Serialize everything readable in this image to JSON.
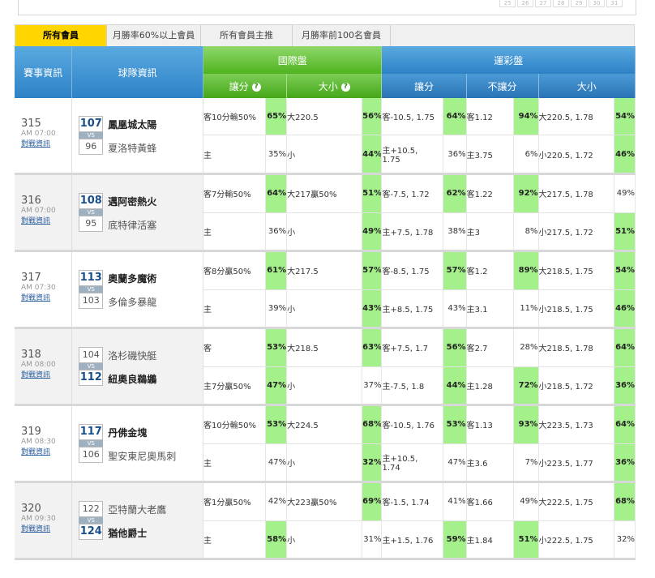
{
  "calendar_days": [
    "25",
    "26",
    "27",
    "28",
    "29",
    "30",
    "31"
  ],
  "tabs": [
    {
      "label": "所有會員",
      "active": true
    },
    {
      "label": "月勝率60%以上會員",
      "active": false
    },
    {
      "label": "所有會員主推",
      "active": false
    },
    {
      "label": "月勝率前100名會員",
      "active": false
    }
  ],
  "header": {
    "match_info": "賽事資訊",
    "team_info": "球隊資訊",
    "intl": "國際盤",
    "sports_lottery": "運彩盤",
    "intl_spread": "讓分",
    "intl_total": "大小",
    "help_icon": "?",
    "lot_spread": "讓分",
    "lot_nospread": "不讓分",
    "lot_total": "大小"
  },
  "colors": {
    "highlight": "#a4f08a",
    "tab_active": "#ffd600",
    "green_header": "#4eb31d",
    "blue_header": "#2d82c6"
  },
  "games": [
    {
      "id": "315",
      "time": "AM 07:00",
      "link": "對戰資訊",
      "top": {
        "num": "107",
        "name": "鳳凰城太陽",
        "big": true
      },
      "bottom": {
        "num": "96",
        "name": "夏洛特黃蜂",
        "big": false
      },
      "rows": [
        [
          [
            "客10分輸50%",
            "65%",
            1
          ],
          [
            "大220.5",
            "56%",
            1
          ],
          [
            "客-10.5, 1.75",
            "64%",
            1
          ],
          [
            "客1.12",
            "94%",
            1
          ],
          [
            "大220.5, 1.78",
            "54%",
            1
          ]
        ],
        [
          [
            "主",
            "35%",
            0
          ],
          [
            "小",
            "44%",
            1
          ],
          [
            "主+10.5,\n1.75",
            "36%",
            0
          ],
          [
            "主3.75",
            "6%",
            0
          ],
          [
            "小220.5, 1.72",
            "46%",
            1
          ]
        ]
      ]
    },
    {
      "id": "316",
      "time": "AM 07:00",
      "link": "對戰資訊",
      "top": {
        "num": "108",
        "name": "邁阿密熱火",
        "big": true
      },
      "bottom": {
        "num": "95",
        "name": "底特律活塞",
        "big": false
      },
      "rows": [
        [
          [
            "客7分輸50%",
            "64%",
            1
          ],
          [
            "大217贏50%",
            "51%",
            1
          ],
          [
            "客-7.5, 1.72",
            "62%",
            1
          ],
          [
            "客1.22",
            "92%",
            1
          ],
          [
            "大217.5, 1.78",
            "49%",
            0
          ]
        ],
        [
          [
            "主",
            "36%",
            0
          ],
          [
            "小",
            "49%",
            1
          ],
          [
            "主+7.5, 1.78",
            "38%",
            0
          ],
          [
            "主3",
            "8%",
            0
          ],
          [
            "小217.5, 1.72",
            "51%",
            1
          ]
        ]
      ]
    },
    {
      "id": "317",
      "time": "AM 07:30",
      "link": "對戰資訊",
      "top": {
        "num": "113",
        "name": "奧蘭多魔術",
        "big": true
      },
      "bottom": {
        "num": "103",
        "name": "多倫多暴龍",
        "big": false
      },
      "rows": [
        [
          [
            "客8分贏50%",
            "61%",
            1
          ],
          [
            "大217.5",
            "57%",
            1
          ],
          [
            "客-8.5, 1.75",
            "57%",
            1
          ],
          [
            "客1.2",
            "89%",
            1
          ],
          [
            "大218.5, 1.75",
            "54%",
            1
          ]
        ],
        [
          [
            "主",
            "39%",
            0
          ],
          [
            "小",
            "43%",
            1
          ],
          [
            "主+8.5, 1.75",
            "43%",
            0
          ],
          [
            "主3.1",
            "11%",
            0
          ],
          [
            "小218.5, 1.75",
            "46%",
            1
          ]
        ]
      ]
    },
    {
      "id": "318",
      "time": "AM 08:00",
      "link": "對戰資訊",
      "top": {
        "num": "104",
        "name": "洛杉磯快艇",
        "big": false
      },
      "bottom": {
        "num": "112",
        "name": "紐奧良鵜鶘",
        "big": true
      },
      "rows": [
        [
          [
            "客",
            "53%",
            1
          ],
          [
            "大218.5",
            "63%",
            1
          ],
          [
            "客+7.5, 1.7",
            "56%",
            1
          ],
          [
            "客2.7",
            "28%",
            0
          ],
          [
            "大218.5, 1.78",
            "64%",
            1
          ]
        ],
        [
          [
            "主7分贏50%",
            "47%",
            1
          ],
          [
            "小",
            "37%",
            0
          ],
          [
            "主-7.5, 1.8",
            "44%",
            1
          ],
          [
            "主1.28",
            "72%",
            1
          ],
          [
            "小218.5, 1.72",
            "36%",
            1
          ]
        ]
      ]
    },
    {
      "id": "319",
      "time": "AM 08:30",
      "link": "對戰資訊",
      "top": {
        "num": "117",
        "name": "丹佛金塊",
        "big": true
      },
      "bottom": {
        "num": "106",
        "name": "聖安東尼奧馬刺",
        "big": false
      },
      "rows": [
        [
          [
            "客10分輸50%",
            "53%",
            1
          ],
          [
            "大224.5",
            "68%",
            1
          ],
          [
            "客-10.5, 1.76",
            "53%",
            1
          ],
          [
            "客1.13",
            "93%",
            1
          ],
          [
            "大223.5, 1.73",
            "64%",
            1
          ]
        ],
        [
          [
            "主",
            "47%",
            0
          ],
          [
            "小",
            "32%",
            1
          ],
          [
            "主+10.5,\n1.74",
            "47%",
            0
          ],
          [
            "主3.6",
            "7%",
            0
          ],
          [
            "小223.5, 1.77",
            "36%",
            1
          ]
        ]
      ]
    },
    {
      "id": "320",
      "time": "AM 09:30",
      "link": "對戰資訊",
      "top": {
        "num": "122",
        "name": "亞特蘭大老鷹",
        "big": false
      },
      "bottom": {
        "num": "124",
        "name": "猶他爵士",
        "big": true
      },
      "rows": [
        [
          [
            "客1分贏50%",
            "42%",
            0
          ],
          [
            "大223贏50%",
            "69%",
            1
          ],
          [
            "客-1.5, 1.74",
            "41%",
            0
          ],
          [
            "客1.66",
            "49%",
            0
          ],
          [
            "大222.5, 1.75",
            "68%",
            1
          ]
        ],
        [
          [
            "主",
            "58%",
            1
          ],
          [
            "小",
            "31%",
            0
          ],
          [
            "主+1.5, 1.76",
            "59%",
            1
          ],
          [
            "主1.84",
            "51%",
            1
          ],
          [
            "小222.5, 1.75",
            "32%",
            0
          ]
        ]
      ]
    }
  ]
}
